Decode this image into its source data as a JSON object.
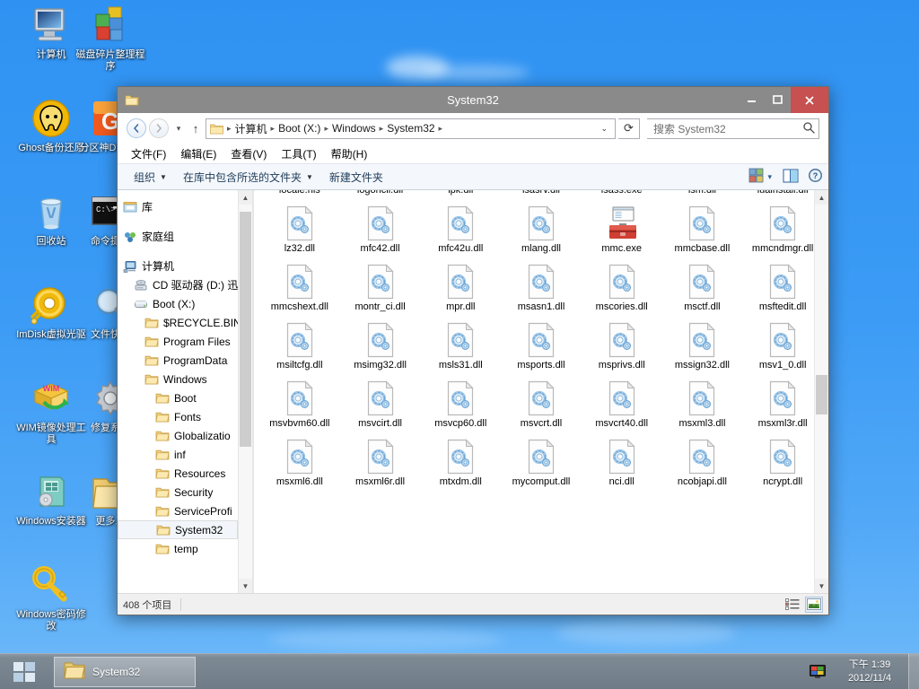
{
  "desktop": {
    "icons": [
      {
        "label": "计算机",
        "icon": "computer-icon"
      },
      {
        "label": "磁盘碎片整理程序",
        "icon": "defragmenter-icon"
      },
      {
        "label": "Ghost备份还原",
        "icon": "ghost-icon"
      },
      {
        "label": "分区神DiskGe",
        "icon": "diskgenius-icon"
      },
      {
        "label": "回收站",
        "icon": "recycle-bin-icon"
      },
      {
        "label": "命令提示",
        "icon": "command-prompt-icon"
      },
      {
        "label": "ImDisk虚拟光驱",
        "icon": "imdisk-icon"
      },
      {
        "label": "文件快速",
        "icon": "file-search-icon"
      },
      {
        "label": "WIM镜像处理工具",
        "icon": "wim-tool-icon"
      },
      {
        "label": "修复系统",
        "icon": "repair-system-icon"
      },
      {
        "label": "Windows安装器",
        "icon": "windows-installer-icon"
      },
      {
        "label": "更多工",
        "icon": "more-tools-folder-icon"
      },
      {
        "label": "Windows密码修改",
        "icon": "password-key-icon"
      }
    ]
  },
  "window": {
    "title": "System32",
    "icon": "folder-icon",
    "buttons": {
      "minimize": "─",
      "maximize": "❐",
      "close": "✕"
    },
    "address": {
      "folder_icon": "folder-icon",
      "crumbs": [
        "计算机",
        "Boot (X:)",
        "Windows",
        "System32"
      ],
      "separator": "▸",
      "dropdown": "⌄",
      "refresh": "⟳",
      "back": "←",
      "forward": "→",
      "recent": "▾",
      "up": "↑"
    },
    "search": {
      "placeholder": "搜索 System32",
      "icon": "search-icon"
    },
    "menus": [
      "文件(F)",
      "编辑(E)",
      "查看(V)",
      "工具(T)",
      "帮助(H)"
    ],
    "toolbar": {
      "organize": "组织",
      "include_in_library": "在库中包含所选的文件夹",
      "new_folder": "新建文件夹",
      "view_icon": "view-options-icon",
      "view_caret": "▾",
      "preview_icon": "preview-pane-icon",
      "help_icon": "help-icon"
    },
    "navpane": [
      {
        "label": "库",
        "icon": "library-icon",
        "indent": 0,
        "spacer_after": true
      },
      {
        "label": "家庭组",
        "icon": "homegroup-icon",
        "indent": 0,
        "spacer_after": true
      },
      {
        "label": "计算机",
        "icon": "computer-icon",
        "indent": 0
      },
      {
        "label": "CD 驱动器 (D:) 迅",
        "icon": "cd-drive-icon",
        "indent": 1
      },
      {
        "label": "Boot (X:)",
        "icon": "hard-drive-icon",
        "indent": 1
      },
      {
        "label": "$RECYCLE.BIN",
        "icon": "folder-icon",
        "indent": 2
      },
      {
        "label": "Program Files",
        "icon": "folder-icon",
        "indent": 2
      },
      {
        "label": "ProgramData",
        "icon": "folder-icon",
        "indent": 2
      },
      {
        "label": "Windows",
        "icon": "folder-icon",
        "indent": 2
      },
      {
        "label": "Boot",
        "icon": "folder-icon",
        "indent": 3
      },
      {
        "label": "Fonts",
        "icon": "folder-icon",
        "indent": 3
      },
      {
        "label": "Globalizatio",
        "icon": "folder-icon",
        "indent": 3
      },
      {
        "label": "inf",
        "icon": "folder-icon",
        "indent": 3
      },
      {
        "label": "Resources",
        "icon": "folder-icon",
        "indent": 3
      },
      {
        "label": "Security",
        "icon": "folder-icon",
        "indent": 3
      },
      {
        "label": "ServiceProfi",
        "icon": "folder-icon",
        "indent": 3
      },
      {
        "label": "System32",
        "icon": "folder-icon",
        "indent": 3,
        "selected": true
      },
      {
        "label": "temp",
        "icon": "folder-icon",
        "indent": 3
      }
    ],
    "files": [
      {
        "name": "locale.nls",
        "icon": "dll-icon"
      },
      {
        "name": "logoncli.dll",
        "icon": "dll-icon"
      },
      {
        "name": "lpk.dll",
        "icon": "dll-icon"
      },
      {
        "name": "lsasrv.dll",
        "icon": "dll-icon"
      },
      {
        "name": "lsass.exe",
        "icon": "exe-toolbox-icon"
      },
      {
        "name": "lsm.dll",
        "icon": "dll-icon"
      },
      {
        "name": "luainstall.dll",
        "icon": "dll-icon"
      },
      {
        "name": "lz32.dll",
        "icon": "dll-icon"
      },
      {
        "name": "mfc42.dll",
        "icon": "dll-icon"
      },
      {
        "name": "mfc42u.dll",
        "icon": "dll-icon"
      },
      {
        "name": "mlang.dll",
        "icon": "dll-icon"
      },
      {
        "name": "mmc.exe",
        "icon": "exe-toolbox-icon"
      },
      {
        "name": "mmcbase.dll",
        "icon": "dll-icon"
      },
      {
        "name": "mmcndmgr.dll",
        "icon": "dll-icon"
      },
      {
        "name": "mmcshext.dll",
        "icon": "dll-icon"
      },
      {
        "name": "montr_ci.dll",
        "icon": "dll-icon"
      },
      {
        "name": "mpr.dll",
        "icon": "dll-icon"
      },
      {
        "name": "msasn1.dll",
        "icon": "dll-icon"
      },
      {
        "name": "mscories.dll",
        "icon": "dll-icon"
      },
      {
        "name": "msctf.dll",
        "icon": "dll-icon"
      },
      {
        "name": "msftedit.dll",
        "icon": "dll-icon"
      },
      {
        "name": "msiltcfg.dll",
        "icon": "dll-icon"
      },
      {
        "name": "msimg32.dll",
        "icon": "dll-icon"
      },
      {
        "name": "msls31.dll",
        "icon": "dll-icon"
      },
      {
        "name": "msports.dll",
        "icon": "dll-icon"
      },
      {
        "name": "msprivs.dll",
        "icon": "dll-icon"
      },
      {
        "name": "mssign32.dll",
        "icon": "dll-icon"
      },
      {
        "name": "msv1_0.dll",
        "icon": "dll-icon"
      },
      {
        "name": "msvbvm60.dll",
        "icon": "dll-icon"
      },
      {
        "name": "msvcirt.dll",
        "icon": "dll-icon"
      },
      {
        "name": "msvcp60.dll",
        "icon": "dll-icon"
      },
      {
        "name": "msvcrt.dll",
        "icon": "dll-icon"
      },
      {
        "name": "msvcrt40.dll",
        "icon": "dll-icon"
      },
      {
        "name": "msxml3.dll",
        "icon": "dll-icon"
      },
      {
        "name": "msxml3r.dll",
        "icon": "dll-icon"
      },
      {
        "name": "msxml6.dll",
        "icon": "dll-icon"
      },
      {
        "name": "msxml6r.dll",
        "icon": "dll-icon"
      },
      {
        "name": "mtxdm.dll",
        "icon": "dll-icon"
      },
      {
        "name": "mycomput.dll",
        "icon": "dll-icon"
      },
      {
        "name": "nci.dll",
        "icon": "dll-icon"
      },
      {
        "name": "ncobjapi.dll",
        "icon": "dll-icon"
      },
      {
        "name": "ncrypt.dll",
        "icon": "dll-icon"
      }
    ],
    "status": {
      "item_count": "408 个项目"
    },
    "status_views": {
      "details": "details-view-icon",
      "large": "large-icons-view-icon"
    }
  },
  "taskbar": {
    "start": "start-button-icon",
    "items": [
      {
        "label": "System32",
        "icon": "folder-icon"
      }
    ],
    "tray_icon": "display-icon",
    "clock_time": "下午 1:39",
    "clock_date": "2012/11/4"
  },
  "colors": {
    "desktop_blue": "#3b9bf5",
    "titlebar": "#8a8a8a",
    "close_red": "#c75050",
    "taskbar": "#7d8993",
    "selection": "#f2f6fb"
  }
}
